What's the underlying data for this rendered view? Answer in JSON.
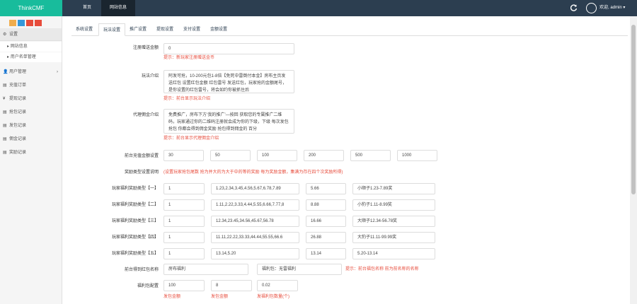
{
  "topbar": {
    "brand": "ThinkCMF",
    "nav_home": "首页",
    "nav_site": "网站信息",
    "user": "欢迎, admin ▾"
  },
  "colors": {
    "topbar": "#2c3e50",
    "brand": "#18bc9c",
    "hint": "#e74c3c",
    "quick": [
      "#f0ad4e",
      "#3498db",
      "#e74c3c",
      "#e74c3c"
    ]
  },
  "sidebar": {
    "settings": {
      "icon": "gear-icon",
      "label": "设置"
    },
    "sub_items": [
      "网站信息",
      "用户名单管理"
    ],
    "menus": [
      {
        "icon": "user-icon",
        "label": "用户管理",
        "arrow": true
      },
      {
        "icon": "list-icon",
        "label": "充值订单",
        "arrow": false
      },
      {
        "icon": "yen-icon",
        "label": "提现记录",
        "arrow": false
      },
      {
        "icon": "list-icon",
        "label": "抢包记录",
        "arrow": false
      },
      {
        "icon": "list-icon",
        "label": "发包记录",
        "arrow": false
      },
      {
        "icon": "list-icon",
        "label": "佣金记录",
        "arrow": false
      },
      {
        "icon": "list-icon",
        "label": "奖励记录",
        "arrow": false
      }
    ]
  },
  "tabs": [
    "系统设置",
    "玩法设置",
    "推广设置",
    "提现设置",
    "支付设置",
    "金额设置"
  ],
  "form": {
    "f1": {
      "label": "注册赠送金额",
      "value": "0",
      "hint": "提示：新玩家注册赠送金币"
    },
    "f2": {
      "label": "玩法介绍",
      "value": "阿发可抢，10-200元包1-8倍【免死中雷倒付本金】房布主页发送红包 设置红包金额 红包雷号 发送红包，玩家抢的金额尾号，是你设置的红包雷号，将会如约你被抓住后",
      "hint": "提示：前台显示玩法介绍"
    },
    "f3": {
      "label": "代理佣金介绍",
      "value": "免费推广，房布下方‘我的推广’—按回 获取您的专属推广二维码，玩家通过你的二维码注册就会成为你的下级，下级 每次发包 抢包 你都会得到佣金奖励 抢包得到佣金的 百分",
      "hint": "提示：前台显示代理佣金介绍"
    },
    "f4": {
      "label": "前台充值金额设置",
      "values": [
        "30",
        "50",
        "100",
        "200",
        "500",
        "1000"
      ]
    },
    "f5": {
      "label": "奖励类型设置说明",
      "hint": "(设置玩家抢包尾数 抢为并大的为大于中的等的奖励 每为奖励金额，集满为存在四个次奖励所得)"
    },
    "rows": [
      {
        "label": "玩家福利奖励类型【一】",
        "cols": [
          "1",
          "1.23,2.34,3.45,4.56,5.67,6.78,7.89",
          "5.66",
          "小顺子1.23-7.89奖"
        ]
      },
      {
        "label": "玩家福利奖励类型【二】",
        "cols": [
          "1",
          "1.11,2.22,3.33,4.44,5.55,6.66,7.77,8",
          "8.88",
          "小豹子1.11-8.99奖"
        ]
      },
      {
        "label": "玩家福利奖励类型【三】",
        "cols": [
          "1",
          "12.34,23.45,34.56,45.67,56.78",
          "16.66",
          "大顺子12.34-56.78奖"
        ]
      },
      {
        "label": "玩家福利奖励类型【四】",
        "cols": [
          "1",
          "11.11,22.22,33.33,44.44,55.55,66.6",
          "26.88",
          "大豹子11.11-99.99奖"
        ]
      },
      {
        "label": "玩家福利奖励类型【五】",
        "cols": [
          "1",
          "13.14,5.20",
          "13.14",
          "5.20-13.14"
        ]
      }
    ],
    "f6": {
      "label": "前台得到红包名称",
      "values": [
        "房布福利",
        "福利包：无雷福利"
      ],
      "hint": "提示：前台福包名称 前为前名称的名称"
    },
    "f7": {
      "label": "福利包配置",
      "values": [
        "100",
        "8",
        "0.02"
      ],
      "hints": [
        "发包金额",
        "发包金额",
        "发福利包数量(个)"
      ]
    }
  }
}
